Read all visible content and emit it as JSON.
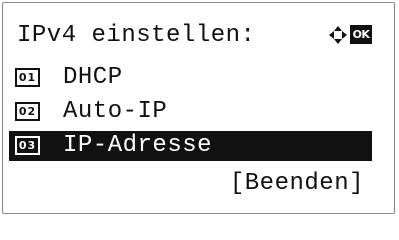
{
  "screen": {
    "title": "IPv4 einstellen:",
    "nav_icon": "four-way-arrow-icon",
    "ok_badge": "OK"
  },
  "menu": {
    "items": [
      {
        "number": "01",
        "label": "DHCP",
        "selected": false
      },
      {
        "number": "02",
        "label": "Auto-IP",
        "selected": false
      },
      {
        "number": "03",
        "label": "IP-Adresse",
        "selected": true
      }
    ]
  },
  "footer": {
    "exit_label": "[Beenden]"
  },
  "colors": {
    "foreground": "#111111",
    "background": "#ffffff",
    "border": "#8a8a8a"
  }
}
